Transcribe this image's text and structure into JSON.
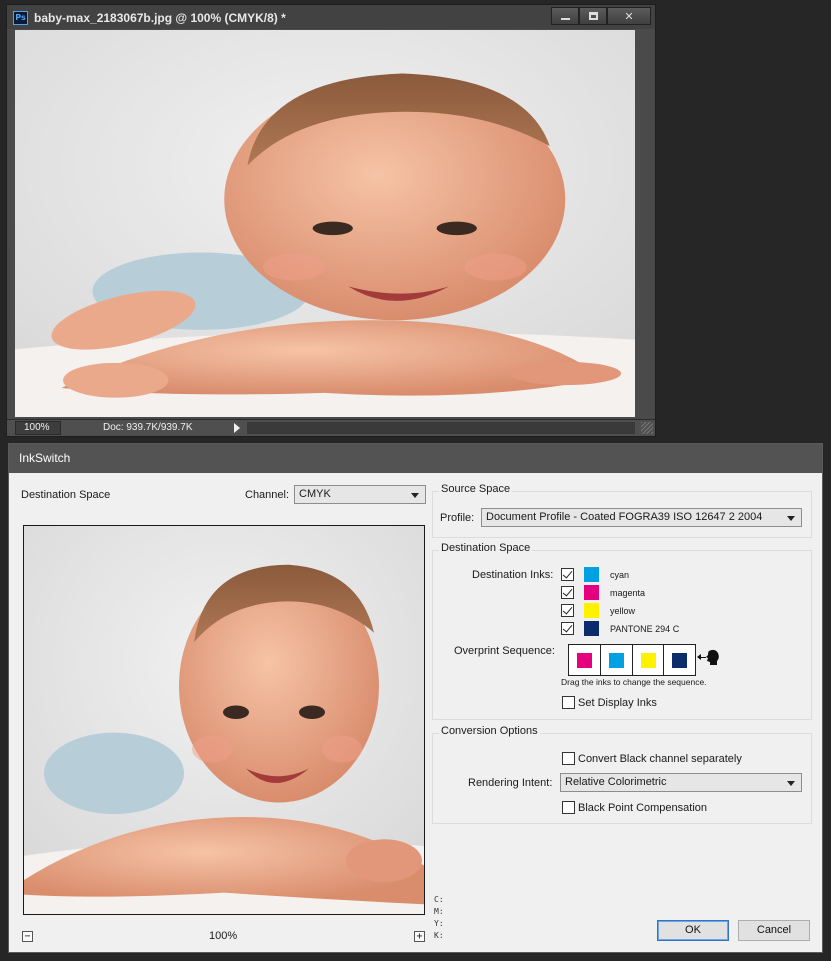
{
  "document": {
    "app_icon": "ps-icon",
    "title": "baby-max_2183067b.jpg @ 100% (CMYK/8) *",
    "zoom": "100%",
    "doc_size": "Doc: 939.7K/939.7K"
  },
  "dialog": {
    "title": "InkSwitch",
    "left": {
      "heading": "Destination Space",
      "channel_label": "Channel:",
      "channel_value": "CMYK",
      "zoom_level": "100%",
      "readout": [
        "C:",
        "M:",
        "Y:",
        "K:"
      ]
    },
    "source_space": {
      "title": "Source Space",
      "profile_label": "Profile:",
      "profile_value": "Document Profile - Coated FOGRA39  ISO 12647 2 2004"
    },
    "destination_space": {
      "title": "Destination Space",
      "inks_label": "Destination Inks:",
      "inks": [
        {
          "name": "cyan",
          "color": "#00a0e3",
          "checked": true
        },
        {
          "name": "magenta",
          "color": "#e4007f",
          "checked": true
        },
        {
          "name": "yellow",
          "color": "#fff100",
          "checked": true
        },
        {
          "name": "PANTONE 294 C",
          "color": "#0b2d6b",
          "checked": true
        }
      ],
      "overprint_label": "Overprint Sequence:",
      "sequence_colors": [
        "#e4007f",
        "#00a0e3",
        "#fff100",
        "#0b2d6b"
      ],
      "drag_hint": "Drag the inks to change the sequence.",
      "set_display_inks": "Set Display Inks"
    },
    "conversion": {
      "title": "Conversion Options",
      "convert_black": "Convert Black channel separately",
      "intent_label": "Rendering Intent:",
      "intent_value": "Relative Colorimetric",
      "bpc": "Black Point Compensation"
    },
    "buttons": {
      "ok": "OK",
      "cancel": "Cancel"
    }
  }
}
